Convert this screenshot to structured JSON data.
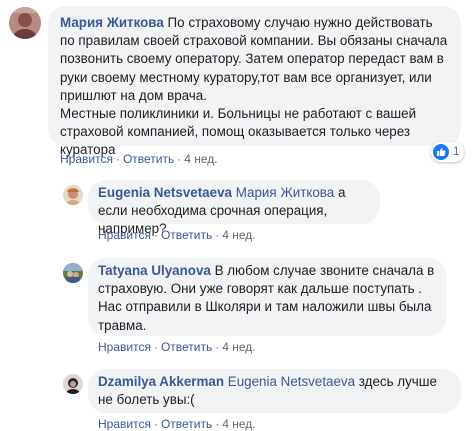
{
  "comments": [
    {
      "author": "Мария Житкова",
      "text": " По страховому случаю нужно действовать по правилам своей страховой компании. Вы обязаны сначала позвонить своему оператору. Затем оператор передаст вам в руки своему местному куратору,тот вам все организует, или пришлют на дом врача.\nМестные поликлиники и. Больницы не работают с вашей страховой компанией, помощ оказывается только через куратора",
      "like": "Нравится",
      "reply": "Ответить",
      "time": "4 нед.",
      "reaction_count": "1",
      "reaction_icon": "like-icon"
    }
  ],
  "replies": [
    {
      "author": "Eugenia Netsvetaeva",
      "mention": "Мария Житкова",
      "text": " а если необходима срочная операция, например?",
      "like": "Нравится",
      "reply": "Ответить",
      "time": "4 нед."
    },
    {
      "author": "Tatyana Ulyanova",
      "mention": "",
      "text": " В любом случае звоните сначала в страховую. Они уже говорят как дальше поступать . Нас отправили в Школяри и там наложили швы была травма.",
      "like": "Нравится",
      "reply": "Ответить",
      "time": "4 нед."
    },
    {
      "author": "Dzamilya Akkerman",
      "mention": "Eugenia Netsvetaeva",
      "text": " здесь лучше не болеть увы:(",
      "like": "Нравится",
      "reply": "Ответить",
      "time": "4 нед."
    }
  ],
  "colors": {
    "link": "#385898",
    "bubble": "#f2f3f5",
    "meta": "#606770",
    "like_badge": "#1877f2"
  }
}
